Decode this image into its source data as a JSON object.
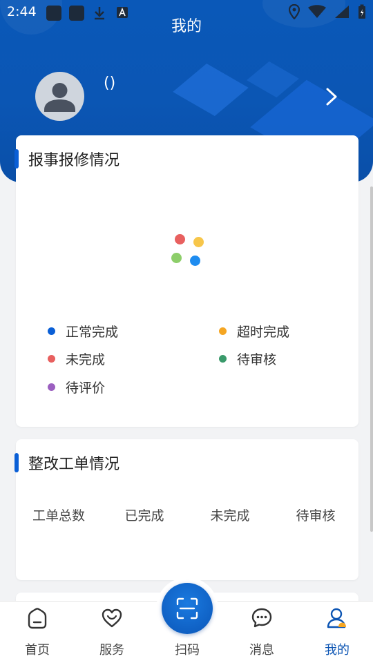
{
  "status_bar": {
    "time": "2:44"
  },
  "header": {
    "title": "我的",
    "username": "()"
  },
  "repair_card": {
    "title": "报事报修情况",
    "legend": [
      {
        "label": "正常完成",
        "color": "#0a5fd6"
      },
      {
        "label": "超时完成",
        "color": "#f5a623"
      },
      {
        "label": "未完成",
        "color": "#e8605f"
      },
      {
        "label": "待审核",
        "color": "#3a9a6b"
      },
      {
        "label": "待评价",
        "color": "#9b5fc0"
      }
    ],
    "loading_dots": [
      "#e8605f",
      "#f7c64a",
      "#8dce6a",
      "#1e8cf0"
    ]
  },
  "rectify_card": {
    "title": "整改工单情况",
    "stats": [
      "工单总数",
      "已完成",
      "未完成",
      "待审核"
    ]
  },
  "bottom_nav": {
    "items": [
      {
        "label": "首页",
        "icon": "home-icon"
      },
      {
        "label": "服务",
        "icon": "heart-icon"
      },
      {
        "label": "扫码",
        "icon": "scan-icon"
      },
      {
        "label": "消息",
        "icon": "message-icon"
      },
      {
        "label": "我的",
        "icon": "profile-icon",
        "active": true
      }
    ]
  }
}
